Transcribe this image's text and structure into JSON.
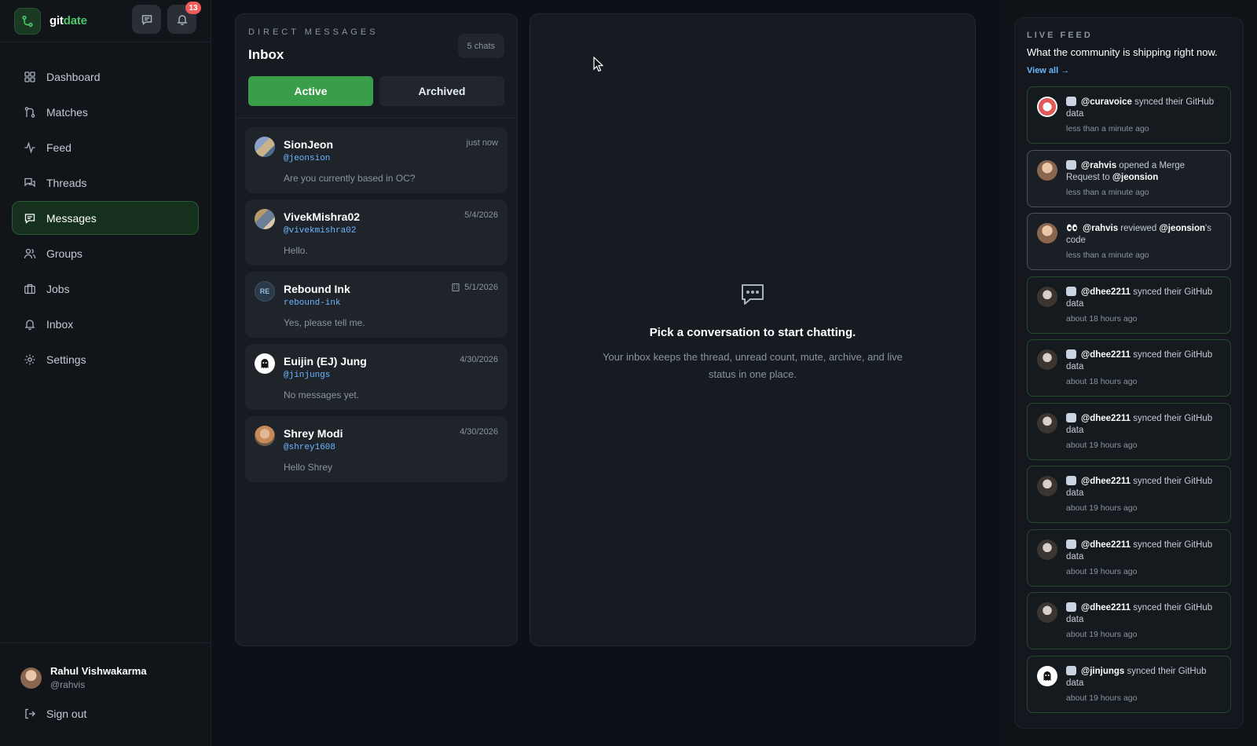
{
  "app": {
    "brand_part1": "git",
    "brand_part2": "date",
    "notification_count": "13"
  },
  "sidebar": {
    "items": [
      {
        "label": "Dashboard",
        "icon": "dashboard-icon"
      },
      {
        "label": "Matches",
        "icon": "git-merge-icon"
      },
      {
        "label": "Feed",
        "icon": "activity-icon"
      },
      {
        "label": "Threads",
        "icon": "threads-icon"
      },
      {
        "label": "Messages",
        "icon": "message-icon",
        "active": true
      },
      {
        "label": "Groups",
        "icon": "users-icon"
      },
      {
        "label": "Jobs",
        "icon": "briefcase-icon"
      },
      {
        "label": "Inbox",
        "icon": "bell-icon"
      },
      {
        "label": "Settings",
        "icon": "gear-icon"
      }
    ],
    "user": {
      "name": "Rahul Vishwakarma",
      "handle": "@rahvis"
    },
    "sign_out": "Sign out"
  },
  "dm": {
    "eyebrow": "DIRECT MESSAGES",
    "title": "Inbox",
    "count": "5 chats",
    "tabs": {
      "active": "Active",
      "archived": "Archived"
    },
    "conversations": [
      {
        "name": "SionJeon",
        "handle": "@jeonsion",
        "time": "just now",
        "preview": "Are you currently based in OC?"
      },
      {
        "name": "VivekMishra02",
        "handle": "@vivekmishra02",
        "time": "5/4/2026",
        "preview": "Hello."
      },
      {
        "name": "Rebound Ink",
        "handle": "rebound-ink",
        "time": "5/1/2026",
        "preview": "Yes, please tell me.",
        "initials": "RE"
      },
      {
        "name": "Euijin (EJ) Jung",
        "handle": "@jinjungs",
        "time": "4/30/2026",
        "preview": "No messages yet."
      },
      {
        "name": "Shrey Modi",
        "handle": "@shrey1608",
        "time": "4/30/2026",
        "preview": "Hello Shrey"
      }
    ]
  },
  "chat": {
    "empty_title": "Pick a conversation to start chatting.",
    "empty_text": "Your inbox keeps the thread, unread count, mute, archive, and live status in one place."
  },
  "feed": {
    "eyebrow": "LIVE FEED",
    "subtitle": "What the community is shipping right now.",
    "view_all": "View all →",
    "items": [
      {
        "user": "@curavoice",
        "action": " synced their GitHub data",
        "target": "",
        "suffix": "",
        "time": "less than a minute ago"
      },
      {
        "user": "@rahvis",
        "action": " opened a Merge Request to ",
        "target": "@jeonsion",
        "suffix": "",
        "time": "less than a minute ago"
      },
      {
        "user": "@rahvis",
        "action": " reviewed ",
        "target": "@jeonsion",
        "suffix": "'s code",
        "time": "less than a minute ago"
      },
      {
        "user": "@dhee2211",
        "action": " synced their GitHub data",
        "target": "",
        "suffix": "",
        "time": "about 18 hours ago"
      },
      {
        "user": "@dhee2211",
        "action": " synced their GitHub data",
        "target": "",
        "suffix": "",
        "time": "about 18 hours ago"
      },
      {
        "user": "@dhee2211",
        "action": " synced their GitHub data",
        "target": "",
        "suffix": "",
        "time": "about 19 hours ago"
      },
      {
        "user": "@dhee2211",
        "action": " synced their GitHub data",
        "target": "",
        "suffix": "",
        "time": "about 19 hours ago"
      },
      {
        "user": "@dhee2211",
        "action": " synced their GitHub data",
        "target": "",
        "suffix": "",
        "time": "about 19 hours ago"
      },
      {
        "user": "@dhee2211",
        "action": " synced their GitHub data",
        "target": "",
        "suffix": "",
        "time": "about 19 hours ago"
      },
      {
        "user": "@jinjungs",
        "action": " synced their GitHub data",
        "target": "",
        "suffix": "",
        "time": "about 19 hours ago"
      }
    ]
  },
  "colors": {
    "accent": "#3a9d49",
    "link": "#6cb6ff",
    "background": "#0d1117",
    "badge": "#ef5a5a"
  }
}
